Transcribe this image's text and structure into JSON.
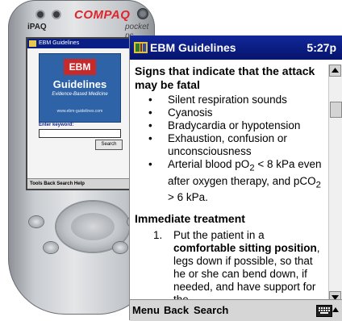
{
  "device": {
    "brand": "COMPAQ",
    "model_left": "iPAQ",
    "model_right": "pocket pc",
    "small_screen": {
      "title": "EBM Guidelines",
      "time": "1:",
      "logo_top": "EBM",
      "logo_main": "Guidelines",
      "logo_sub": "Evidence-Based Medicine",
      "logo_url": "www.ebm-guidelines.com",
      "keyword_label": "Enter keyword:",
      "search_button": "Search",
      "menu": "Tools Back Search Help"
    }
  },
  "screen": {
    "title": "EBM Guidelines",
    "time": "5:27p",
    "section1": {
      "heading": "Signs that indicate that the attack may be fatal",
      "bullet": "•",
      "items": [
        "Silent respiration sounds",
        "Cyanosis",
        "Bradycardia or hypotension",
        "Exhaustion, confusion or unconsciousness"
      ],
      "blood_gas": {
        "prefix": "Arterial blood pO",
        "sub1": "2",
        "mid": " < 8 kPa even after oxygen therapy, and pCO",
        "sub2": "2",
        "suffix": " > 6 kPa."
      }
    },
    "section2": {
      "heading": "Immediate treatment",
      "step_number": "1.",
      "step_pre": "Put the patient in a ",
      "step_bold": "comfortable sitting position",
      "step_post": ", legs down if possible, so that he or she can bend down, if needed, and have support for the"
    },
    "menu": {
      "menu": "Menu",
      "back": "Back",
      "search": "Search"
    },
    "icons": {
      "app": "ebm-book-icon",
      "keyboard": "keyboard-icon",
      "sip": "sip-up-arrow-icon"
    },
    "colors": {
      "titlebar": "#0a1f86",
      "brand": "#e1242a"
    }
  }
}
